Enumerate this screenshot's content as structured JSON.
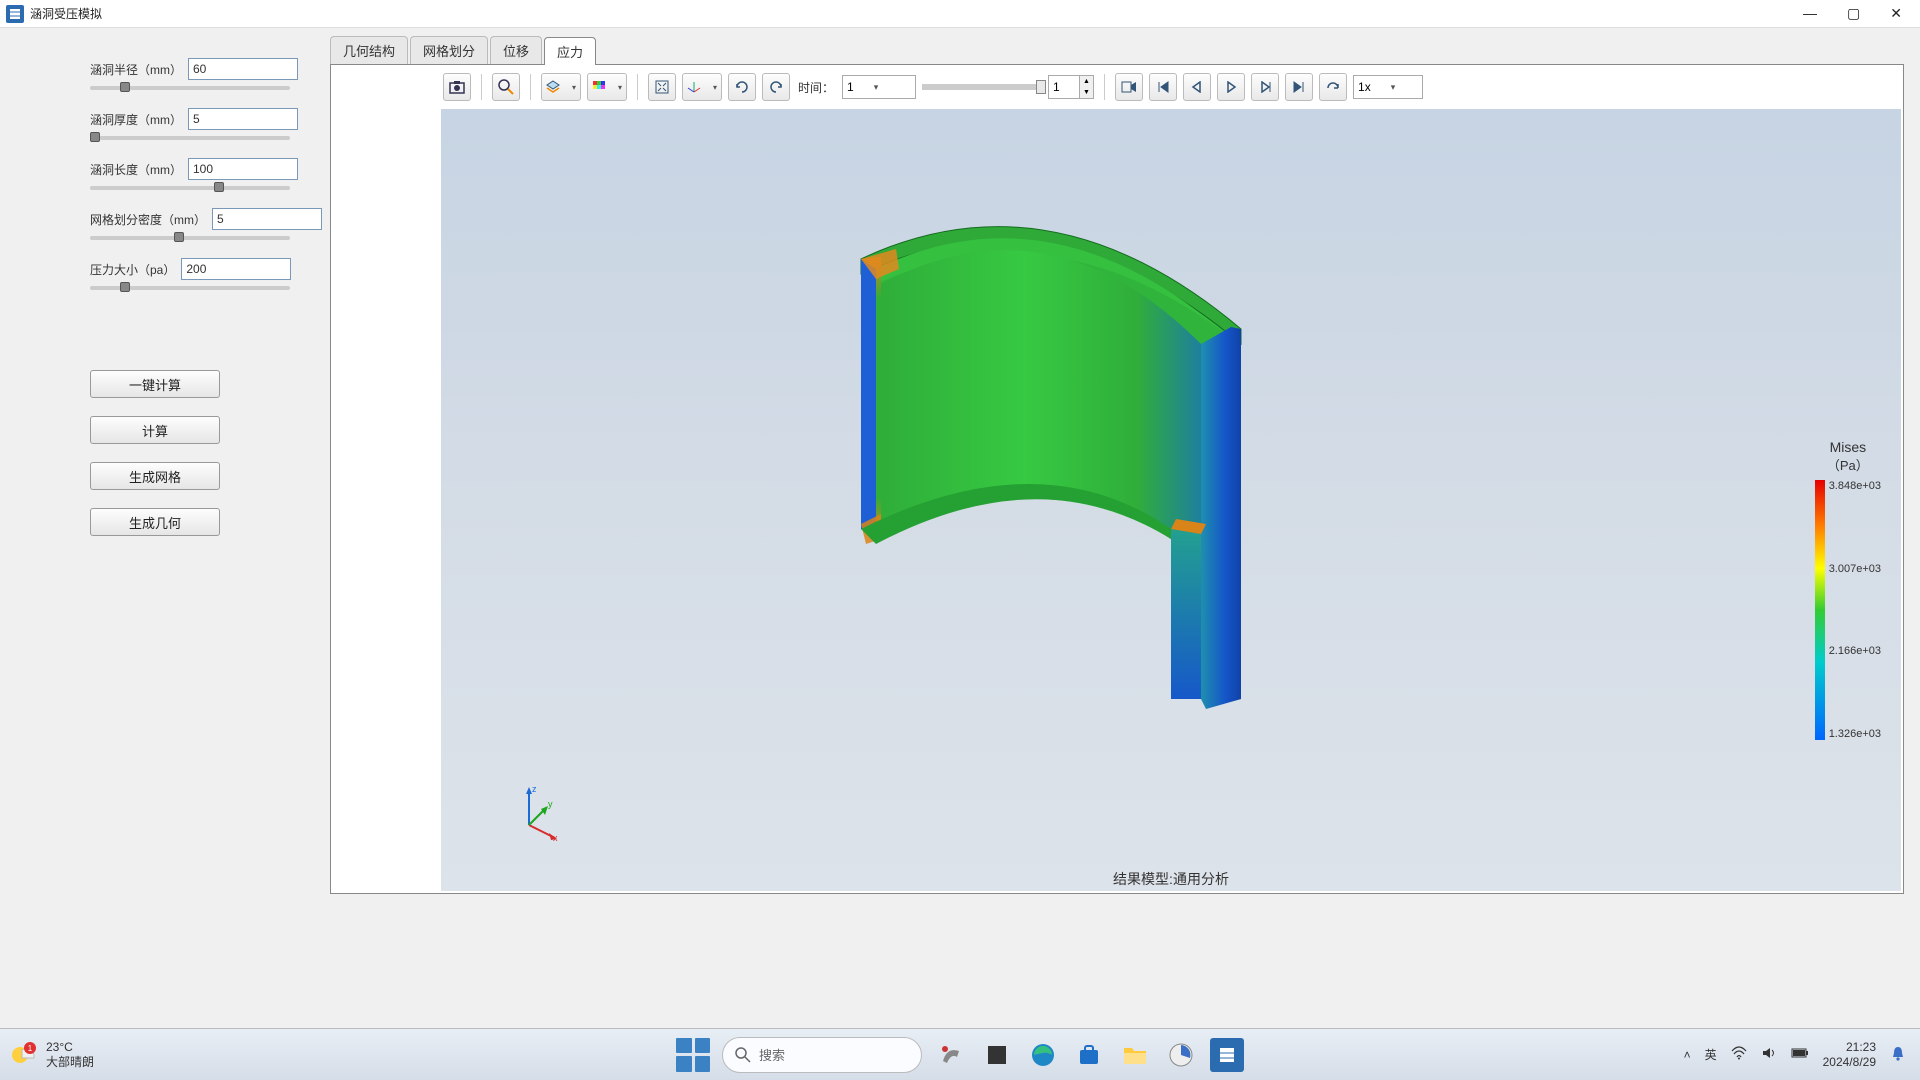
{
  "window": {
    "title": "涵洞受压模拟"
  },
  "tabs": [
    {
      "label": "几何结构",
      "active": false
    },
    {
      "label": "网格划分",
      "active": false
    },
    {
      "label": "位移",
      "active": false
    },
    {
      "label": "应力",
      "active": true
    }
  ],
  "params": {
    "radius": {
      "label": "涵洞半径（mm）",
      "value": "60",
      "thumb_pct": 15
    },
    "thickness": {
      "label": "涵洞厚度（mm）",
      "value": "5",
      "thumb_pct": 0
    },
    "length": {
      "label": "涵洞长度（mm）",
      "value": "100",
      "thumb_pct": 62
    },
    "mesh": {
      "label": "网格划分密度（mm）",
      "value": "5",
      "thumb_pct": 42
    },
    "pressure": {
      "label": "压力大小（pa）",
      "value": "200",
      "thumb_pct": 15
    }
  },
  "buttons": {
    "one_click": "一键计算",
    "compute": "计算",
    "gen_mesh": "生成网格",
    "gen_geom": "生成几何"
  },
  "toolbar": {
    "time_label": "时间：",
    "time_select": "1",
    "spinner": "1",
    "speed_select": "1x"
  },
  "legend": {
    "title": "Mises",
    "unit": "（Pa）",
    "ticks": [
      "3.848e+03",
      "3.007e+03",
      "2.166e+03",
      "1.326e+03"
    ]
  },
  "result_caption": "结果模型:通用分析",
  "axes": {
    "x": "x",
    "y": "y",
    "z": "z"
  },
  "taskbar": {
    "weather_temp": "23°C",
    "weather_desc": "大部晴朗",
    "weather_badge": "1",
    "search_placeholder": "搜索",
    "ime": "英",
    "time": "21:23",
    "date": "2024/8/29",
    "chevron": "˄"
  }
}
